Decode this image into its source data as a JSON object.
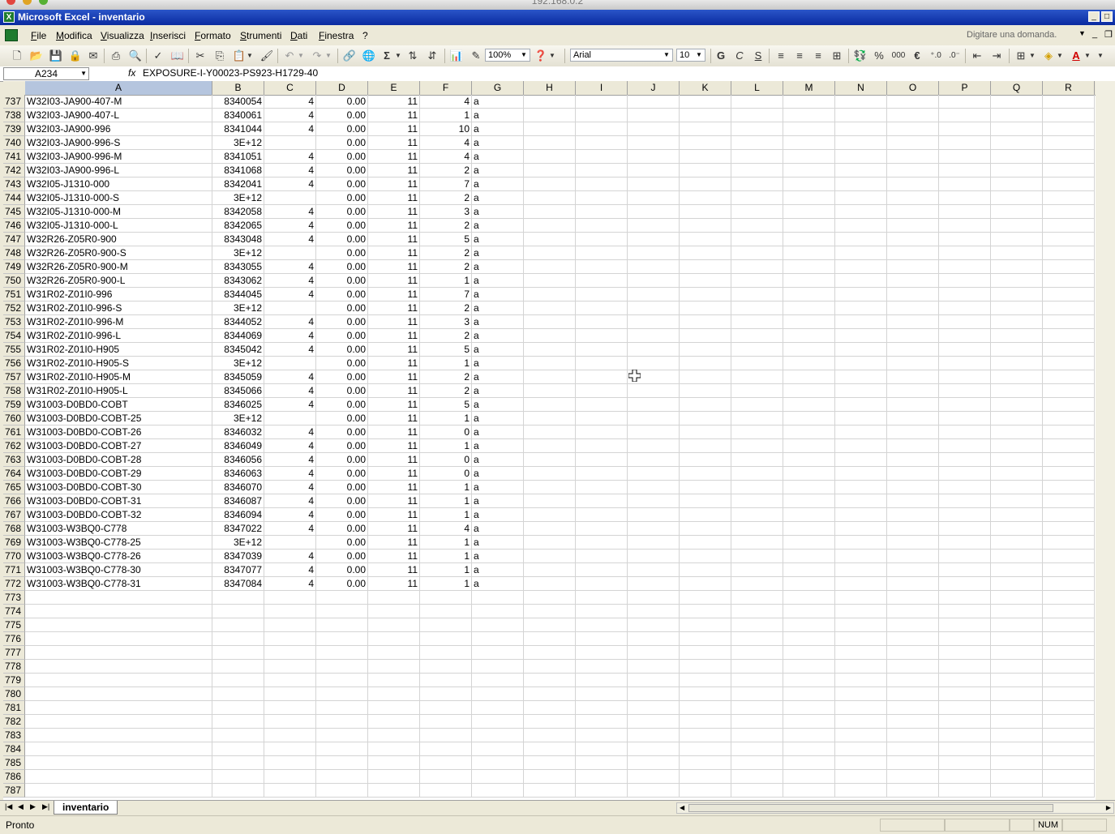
{
  "host": "192.168.0.2",
  "window": {
    "title": "Microsoft Excel - inventario",
    "app_icon": "X"
  },
  "menu": {
    "items": [
      "File",
      "Modifica",
      "Visualizza",
      "Inserisci",
      "Formato",
      "Strumenti",
      "Dati",
      "Finestra",
      "?"
    ],
    "help_placeholder": "Digitare una domanda."
  },
  "toolbar": {
    "zoom": "100%",
    "font": "Arial",
    "size": "10",
    "bold": "G",
    "italic": "C",
    "underline": "S",
    "percent": "%",
    "thousands": "000",
    "euro": "€"
  },
  "formula_bar": {
    "name_box": "A234",
    "fx": "fx",
    "formula": "EXPOSURE-I-Y00023-PS923-H1729-40"
  },
  "columns": [
    "A",
    "B",
    "C",
    "D",
    "E",
    "F",
    "G",
    "H",
    "I",
    "J",
    "K",
    "L",
    "M",
    "N",
    "O",
    "P",
    "Q",
    "R"
  ],
  "rows": [
    {
      "n": "737",
      "a": "W32I03-JA900-407-M",
      "b": "8340054",
      "c": "4",
      "d": "0.00",
      "e": "11",
      "f": "4",
      "g": "a"
    },
    {
      "n": "738",
      "a": "W32I03-JA900-407-L",
      "b": "8340061",
      "c": "4",
      "d": "0.00",
      "e": "11",
      "f": "1",
      "g": "a"
    },
    {
      "n": "739",
      "a": "W32I03-JA900-996",
      "b": "8341044",
      "c": "4",
      "d": "0.00",
      "e": "11",
      "f": "10",
      "g": "a"
    },
    {
      "n": "740",
      "a": "W32I03-JA900-996-S",
      "b": "3E+12",
      "c": "",
      "d": "0.00",
      "e": "11",
      "f": "4",
      "g": "a"
    },
    {
      "n": "741",
      "a": "W32I03-JA900-996-M",
      "b": "8341051",
      "c": "4",
      "d": "0.00",
      "e": "11",
      "f": "4",
      "g": "a"
    },
    {
      "n": "742",
      "a": "W32I03-JA900-996-L",
      "b": "8341068",
      "c": "4",
      "d": "0.00",
      "e": "11",
      "f": "2",
      "g": "a"
    },
    {
      "n": "743",
      "a": "W32I05-J1310-000",
      "b": "8342041",
      "c": "4",
      "d": "0.00",
      "e": "11",
      "f": "7",
      "g": "a"
    },
    {
      "n": "744",
      "a": "W32I05-J1310-000-S",
      "b": "3E+12",
      "c": "",
      "d": "0.00",
      "e": "11",
      "f": "2",
      "g": "a"
    },
    {
      "n": "745",
      "a": "W32I05-J1310-000-M",
      "b": "8342058",
      "c": "4",
      "d": "0.00",
      "e": "11",
      "f": "3",
      "g": "a"
    },
    {
      "n": "746",
      "a": "W32I05-J1310-000-L",
      "b": "8342065",
      "c": "4",
      "d": "0.00",
      "e": "11",
      "f": "2",
      "g": "a"
    },
    {
      "n": "747",
      "a": "W32R26-Z05R0-900",
      "b": "8343048",
      "c": "4",
      "d": "0.00",
      "e": "11",
      "f": "5",
      "g": "a"
    },
    {
      "n": "748",
      "a": "W32R26-Z05R0-900-S",
      "b": "3E+12",
      "c": "",
      "d": "0.00",
      "e": "11",
      "f": "2",
      "g": "a"
    },
    {
      "n": "749",
      "a": "W32R26-Z05R0-900-M",
      "b": "8343055",
      "c": "4",
      "d": "0.00",
      "e": "11",
      "f": "2",
      "g": "a"
    },
    {
      "n": "750",
      "a": "W32R26-Z05R0-900-L",
      "b": "8343062",
      "c": "4",
      "d": "0.00",
      "e": "11",
      "f": "1",
      "g": "a"
    },
    {
      "n": "751",
      "a": "W31R02-Z01I0-996",
      "b": "8344045",
      "c": "4",
      "d": "0.00",
      "e": "11",
      "f": "7",
      "g": "a"
    },
    {
      "n": "752",
      "a": "W31R02-Z01I0-996-S",
      "b": "3E+12",
      "c": "",
      "d": "0.00",
      "e": "11",
      "f": "2",
      "g": "a"
    },
    {
      "n": "753",
      "a": "W31R02-Z01I0-996-M",
      "b": "8344052",
      "c": "4",
      "d": "0.00",
      "e": "11",
      "f": "3",
      "g": "a"
    },
    {
      "n": "754",
      "a": "W31R02-Z01I0-996-L",
      "b": "8344069",
      "c": "4",
      "d": "0.00",
      "e": "11",
      "f": "2",
      "g": "a"
    },
    {
      "n": "755",
      "a": "W31R02-Z01I0-H905",
      "b": "8345042",
      "c": "4",
      "d": "0.00",
      "e": "11",
      "f": "5",
      "g": "a"
    },
    {
      "n": "756",
      "a": "W31R02-Z01I0-H905-S",
      "b": "3E+12",
      "c": "",
      "d": "0.00",
      "e": "11",
      "f": "1",
      "g": "a"
    },
    {
      "n": "757",
      "a": "W31R02-Z01I0-H905-M",
      "b": "8345059",
      "c": "4",
      "d": "0.00",
      "e": "11",
      "f": "2",
      "g": "a"
    },
    {
      "n": "758",
      "a": "W31R02-Z01I0-H905-L",
      "b": "8345066",
      "c": "4",
      "d": "0.00",
      "e": "11",
      "f": "2",
      "g": "a"
    },
    {
      "n": "759",
      "a": "W31003-D0BD0-COBT",
      "b": "8346025",
      "c": "4",
      "d": "0.00",
      "e": "11",
      "f": "5",
      "g": "a"
    },
    {
      "n": "760",
      "a": "W31003-D0BD0-COBT-25",
      "b": "3E+12",
      "c": "",
      "d": "0.00",
      "e": "11",
      "f": "1",
      "g": "a"
    },
    {
      "n": "761",
      "a": "W31003-D0BD0-COBT-26",
      "b": "8346032",
      "c": "4",
      "d": "0.00",
      "e": "11",
      "f": "0",
      "g": "a"
    },
    {
      "n": "762",
      "a": "W31003-D0BD0-COBT-27",
      "b": "8346049",
      "c": "4",
      "d": "0.00",
      "e": "11",
      "f": "1",
      "g": "a"
    },
    {
      "n": "763",
      "a": "W31003-D0BD0-COBT-28",
      "b": "8346056",
      "c": "4",
      "d": "0.00",
      "e": "11",
      "f": "0",
      "g": "a"
    },
    {
      "n": "764",
      "a": "W31003-D0BD0-COBT-29",
      "b": "8346063",
      "c": "4",
      "d": "0.00",
      "e": "11",
      "f": "0",
      "g": "a"
    },
    {
      "n": "765",
      "a": "W31003-D0BD0-COBT-30",
      "b": "8346070",
      "c": "4",
      "d": "0.00",
      "e": "11",
      "f": "1",
      "g": "a"
    },
    {
      "n": "766",
      "a": "W31003-D0BD0-COBT-31",
      "b": "8346087",
      "c": "4",
      "d": "0.00",
      "e": "11",
      "f": "1",
      "g": "a"
    },
    {
      "n": "767",
      "a": "W31003-D0BD0-COBT-32",
      "b": "8346094",
      "c": "4",
      "d": "0.00",
      "e": "11",
      "f": "1",
      "g": "a"
    },
    {
      "n": "768",
      "a": "W31003-W3BQ0-C778",
      "b": "8347022",
      "c": "4",
      "d": "0.00",
      "e": "11",
      "f": "4",
      "g": "a"
    },
    {
      "n": "769",
      "a": "W31003-W3BQ0-C778-25",
      "b": "3E+12",
      "c": "",
      "d": "0.00",
      "e": "11",
      "f": "1",
      "g": "a"
    },
    {
      "n": "770",
      "a": "W31003-W3BQ0-C778-26",
      "b": "8347039",
      "c": "4",
      "d": "0.00",
      "e": "11",
      "f": "1",
      "g": "a"
    },
    {
      "n": "771",
      "a": "W31003-W3BQ0-C778-30",
      "b": "8347077",
      "c": "4",
      "d": "0.00",
      "e": "11",
      "f": "1",
      "g": "a"
    },
    {
      "n": "772",
      "a": "W31003-W3BQ0-C778-31",
      "b": "8347084",
      "c": "4",
      "d": "0.00",
      "e": "11",
      "f": "1",
      "g": "a"
    },
    {
      "n": "773"
    },
    {
      "n": "774"
    },
    {
      "n": "775"
    },
    {
      "n": "776"
    },
    {
      "n": "777"
    },
    {
      "n": "778"
    },
    {
      "n": "779"
    },
    {
      "n": "780"
    },
    {
      "n": "781"
    },
    {
      "n": "782"
    },
    {
      "n": "783"
    },
    {
      "n": "784"
    },
    {
      "n": "785"
    },
    {
      "n": "786"
    },
    {
      "n": "787"
    }
  ],
  "sheet_tab": "inventario",
  "status": {
    "text": "Pronto",
    "num": "NUM"
  }
}
